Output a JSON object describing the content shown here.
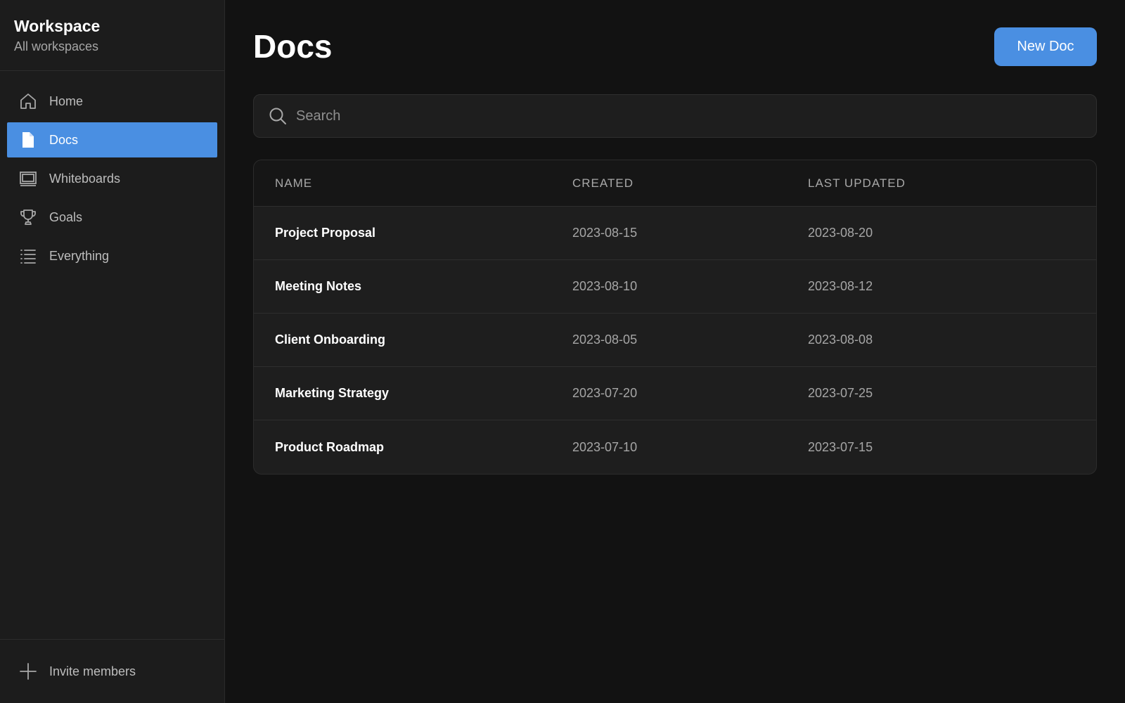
{
  "workspace": {
    "title": "Workspace",
    "subtitle": "All workspaces"
  },
  "nav": [
    {
      "label": "Home",
      "icon": "home-icon",
      "active": false
    },
    {
      "label": "Docs",
      "icon": "document-icon",
      "active": true
    },
    {
      "label": "Whiteboards",
      "icon": "whiteboard-icon",
      "active": false
    },
    {
      "label": "Goals",
      "icon": "trophy-icon",
      "active": false
    },
    {
      "label": "Everything",
      "icon": "list-icon",
      "active": false
    }
  ],
  "footer": {
    "invite_label": "Invite members",
    "icon": "plus-icon"
  },
  "main": {
    "title": "Docs",
    "new_button_label": "New Doc",
    "search_placeholder": "Search"
  },
  "table": {
    "headers": [
      "NAME",
      "CREATED",
      "LAST UPDATED"
    ],
    "rows": [
      {
        "name": "Project Proposal",
        "created": "2023-08-15",
        "updated": "2023-08-20"
      },
      {
        "name": "Meeting Notes",
        "created": "2023-08-10",
        "updated": "2023-08-12"
      },
      {
        "name": "Client Onboarding",
        "created": "2023-08-05",
        "updated": "2023-08-08"
      },
      {
        "name": "Marketing Strategy",
        "created": "2023-07-20",
        "updated": "2023-07-25"
      },
      {
        "name": "Product Roadmap",
        "created": "2023-07-10",
        "updated": "2023-07-15"
      }
    ]
  },
  "colors": {
    "accent": "#4a8fe2",
    "background": "#121212",
    "sidebar": "#1c1c1c"
  }
}
